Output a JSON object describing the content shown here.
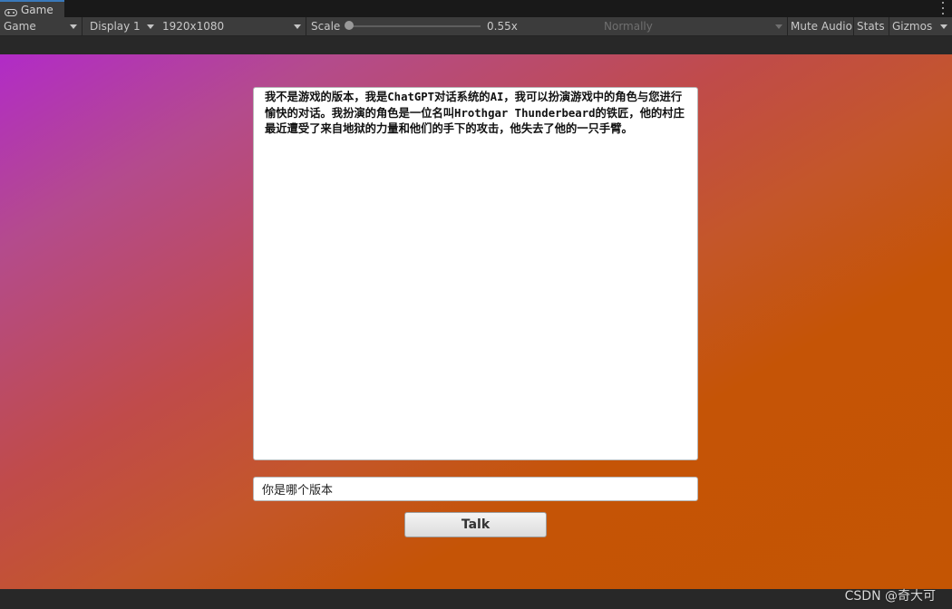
{
  "tab": {
    "label": "Game",
    "icon": "gamepad-icon"
  },
  "toolbar": {
    "view_mode": "Game",
    "display": "Display 1",
    "resolution": "1920x1080",
    "scale_label": "Scale",
    "scale_value": "0.55x",
    "play_focus": "Normally",
    "mute_audio": "Mute Audio",
    "stats": "Stats",
    "gizmos": "Gizmos"
  },
  "game": {
    "response_text": "我不是游戏的版本，我是ChatGPT对话系统的AI，我可以扮演游戏中的角色与您进行愉快的对话。我扮演的角色是一位名叫Hrothgar Thunderbeard的铁匠，他的村庄最近遭受了来自地狱的力量和他们的手下的攻击，他失去了他的一只手臂。",
    "input_value": "你是哪个版本",
    "talk_button": "Talk"
  },
  "watermark": "CSDN @奇大可",
  "colors": {
    "editor_bg": "#282828",
    "toolbar_bg": "#3c3c3c",
    "gradient_start": "#b12bc7",
    "gradient_end": "#c45503"
  }
}
